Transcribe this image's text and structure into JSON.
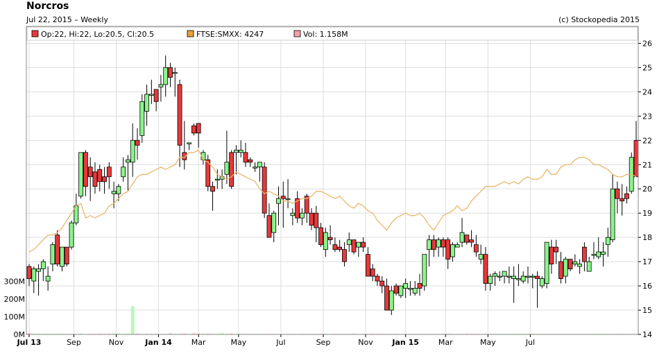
{
  "header": {
    "title": "Norcros",
    "subtitle": "Jul 22, 2015 – Weekly",
    "copyright": "(c) Stockopedia 2015"
  },
  "legend": [
    {
      "label": "Op:22, Hi:22, Lo:20.5, Cl:20.5",
      "color": "#e8383a"
    },
    {
      "label": "FTSE:SMXX: 4247",
      "color": "#e8a23a"
    },
    {
      "label": "Vol: 1.158M",
      "color": "#f2a0a8"
    }
  ],
  "colors": {
    "up": "#8af58a",
    "down": "#e8383a",
    "index_line": "#e9b76a",
    "grid": "#dddddd"
  },
  "chart_data": {
    "type": "candlestick",
    "x_ticks": [
      {
        "label": "Jul 13",
        "bold": true
      },
      {
        "label": "Sep",
        "bold": false
      },
      {
        "label": "Nov",
        "bold": false
      },
      {
        "label": "Jan 14",
        "bold": true
      },
      {
        "label": "Mar",
        "bold": false
      },
      {
        "label": "May",
        "bold": false
      },
      {
        "label": "Jul",
        "bold": false
      },
      {
        "label": "Sep",
        "bold": false
      },
      {
        "label": "Nov",
        "bold": false
      },
      {
        "label": "Jan 15",
        "bold": true
      },
      {
        "label": "Mar",
        "bold": false
      },
      {
        "label": "May",
        "bold": false
      },
      {
        "label": "Jul",
        "bold": false
      }
    ],
    "x_tick_weeks": [
      0,
      9.5,
      18.5,
      27.5,
      36,
      44.5,
      53.5,
      62.5,
      71.5,
      80,
      88.5,
      97.5,
      106.5
    ],
    "y_right_ticks": [
      14,
      15,
      16,
      17,
      18,
      19,
      20,
      21,
      22,
      23,
      24,
      25,
      26
    ],
    "ylim": [
      14,
      26.7
    ],
    "volume_ticks": [
      "0M",
      "100M",
      "200M",
      "300M"
    ],
    "volume_max": 330,
    "series": [
      {
        "name": "Norcros",
        "ohlc": [
          [
            16.8,
            16.9,
            16,
            16.3
          ],
          [
            16.2,
            16.8,
            15.7,
            16.7
          ],
          [
            16.6,
            16.9,
            15.6,
            16.7
          ],
          [
            16.7,
            17.1,
            16.2,
            17
          ],
          [
            16.2,
            16.8,
            15.8,
            16.4
          ],
          [
            16.9,
            17.8,
            16.6,
            17.7
          ],
          [
            18.1,
            18.3,
            16.8,
            16.9
          ],
          [
            16.8,
            17.6,
            16.6,
            17.6
          ],
          [
            17.6,
            17.6,
            16.8,
            16.9
          ],
          [
            17.6,
            18.7,
            17.5,
            18.6
          ],
          [
            18.6,
            19.8,
            18.5,
            19.3
          ],
          [
            19.7,
            21.4,
            19.6,
            21.5
          ],
          [
            21.5,
            21.6,
            19.7,
            20.1
          ],
          [
            20.9,
            21.3,
            19.5,
            20.5
          ],
          [
            20.7,
            21.1,
            19.8,
            20.1
          ],
          [
            20.8,
            21.0,
            19.9,
            20.3
          ],
          [
            20.5,
            20.9,
            19.8,
            20.3
          ],
          [
            20.9,
            21.1,
            20.0,
            20.5
          ],
          [
            19.8,
            20.3,
            19.2,
            19.9
          ],
          [
            19.8,
            20.2,
            19.5,
            20.1
          ],
          [
            20.5,
            21.3,
            20.3,
            20.9
          ],
          [
            21.1,
            21.4,
            19.9,
            21.2
          ],
          [
            21.1,
            22.7,
            20.5,
            22.0
          ],
          [
            22.0,
            22.5,
            21.2,
            21.8
          ],
          [
            22.2,
            23.9,
            21.9,
            23.6
          ],
          [
            23.2,
            24.3,
            22.6,
            23.9
          ],
          [
            23.9,
            24.5,
            23.5,
            23.9
          ],
          [
            24.1,
            24.1,
            23.2,
            23.6
          ],
          [
            24.2,
            24.7,
            23.6,
            24.3
          ],
          [
            24.3,
            25.5,
            23.8,
            25.0
          ],
          [
            25.0,
            25.2,
            24.2,
            24.6
          ],
          [
            24.8,
            25.0,
            23.8,
            24.8
          ],
          [
            24.3,
            24.5,
            20.9,
            21.8
          ],
          [
            21.5,
            22.8,
            20.8,
            21.2
          ],
          [
            21.9,
            21.9,
            21.6,
            21.9
          ],
          [
            22.6,
            22.7,
            22.2,
            22.3
          ],
          [
            22.7,
            22.7,
            21.7,
            22.3
          ],
          [
            21.2,
            21.6,
            21.0,
            21.5
          ],
          [
            21.2,
            21.4,
            19.9,
            20.1
          ],
          [
            20.1,
            20.3,
            19.1,
            19.9
          ],
          [
            20.4,
            20.8,
            20.0,
            20.4
          ],
          [
            20.4,
            20.8,
            20.0,
            20.5
          ],
          [
            20.6,
            22.4,
            20.2,
            21.1
          ],
          [
            21.5,
            21.6,
            20.0,
            20.1
          ],
          [
            21.5,
            21.8,
            20.6,
            21.6
          ],
          [
            21.5,
            22.0,
            21.3,
            21.6
          ],
          [
            21.5,
            21.9,
            20.9,
            21.1
          ],
          [
            21.2,
            21.3,
            20.9,
            21.1
          ],
          [
            20.9,
            21.1,
            20.7,
            20.9
          ],
          [
            20.9,
            21.0,
            20.3,
            21.1
          ],
          [
            20.9,
            21.1,
            18.8,
            19.0
          ],
          [
            18.9,
            19.4,
            18.0,
            18.0
          ],
          [
            18.2,
            19.1,
            17.8,
            19.0
          ],
          [
            19.4,
            20.1,
            18.5,
            19.6
          ],
          [
            19.7,
            20.3,
            18.4,
            19.6
          ],
          [
            19.6,
            20.4,
            19.2,
            19.6
          ],
          [
            18.9,
            19.2,
            18.5,
            19.0
          ],
          [
            19.6,
            19.9,
            18.6,
            18.8
          ],
          [
            18.8,
            19.2,
            18.5,
            19.0
          ],
          [
            19.7,
            19.8,
            18.6,
            19.0
          ],
          [
            19.0,
            19.2,
            18.3,
            18.5
          ],
          [
            19.0,
            19.3,
            17.8,
            18.4
          ],
          [
            18.4,
            18.6,
            17.6,
            17.7
          ],
          [
            17.5,
            18.4,
            17.2,
            18.2
          ],
          [
            18.0,
            18.5,
            17.7,
            17.9
          ],
          [
            17.7,
            18.0,
            17.4,
            17.5
          ],
          [
            17.6,
            17.9,
            17.4,
            17.5
          ],
          [
            17.5,
            17.8,
            16.8,
            17.0
          ],
          [
            17.7,
            18.2,
            17.4,
            17.9
          ],
          [
            17.9,
            17.9,
            17.3,
            17.4
          ],
          [
            17.6,
            17.8,
            17.2,
            17.8
          ],
          [
            17.8,
            18.0,
            17.4,
            17.6
          ],
          [
            17.3,
            17.6,
            16.5,
            16.4
          ],
          [
            16.7,
            16.9,
            16.2,
            16.4
          ],
          [
            16.4,
            16.5,
            16.0,
            16.2
          ],
          [
            16.2,
            16.4,
            15.7,
            16.0
          ],
          [
            16.0,
            16.3,
            15.0,
            15.0
          ],
          [
            15.0,
            16.0,
            14.8,
            15.8
          ],
          [
            16.0,
            16.1,
            15.6,
            15.7
          ],
          [
            15.6,
            16.0,
            15.5,
            16.0
          ],
          [
            15.9,
            16.3,
            15.5,
            16.1
          ],
          [
            15.9,
            16.2,
            15.6,
            15.9
          ],
          [
            15.7,
            16.2,
            15.6,
            15.9
          ],
          [
            16.1,
            16.5,
            15.6,
            15.9
          ],
          [
            16.0,
            17.2,
            15.8,
            17.3
          ],
          [
            17.5,
            18.1,
            16.8,
            17.9
          ],
          [
            17.9,
            18.1,
            17.2,
            17.5
          ],
          [
            17.6,
            18.0,
            17.2,
            17.9
          ],
          [
            17.9,
            18.0,
            17.2,
            17.6
          ],
          [
            17.9,
            18.0,
            16.7,
            17.1
          ],
          [
            17.2,
            17.8,
            17.0,
            17.7
          ],
          [
            17.6,
            17.8,
            17.6,
            17.7
          ],
          [
            17.8,
            18.8,
            17.6,
            18.2
          ],
          [
            18.1,
            18.1,
            17.7,
            17.8
          ],
          [
            17.9,
            18.3,
            17.6,
            17.8
          ],
          [
            17.7,
            18.1,
            17.2,
            17.4
          ],
          [
            17.1,
            17.7,
            16.9,
            17.3
          ],
          [
            17.3,
            17.6,
            15.8,
            16.1
          ],
          [
            16.1,
            16.5,
            15.8,
            16.4
          ],
          [
            16.4,
            16.6,
            16.0,
            16.5
          ],
          [
            16.4,
            16.6,
            16.2,
            16.4
          ],
          [
            16.4,
            16.5,
            16.1,
            16.6
          ],
          [
            16.4,
            16.8,
            16.1,
            16.4
          ],
          [
            16.3,
            16.8,
            15.3,
            16.4
          ],
          [
            16.3,
            16.9,
            16.0,
            16.3
          ],
          [
            16.2,
            16.6,
            16.1,
            16.4
          ],
          [
            16.4,
            16.8,
            16.1,
            16.4
          ],
          [
            16.4,
            16.5,
            15.9,
            16.4
          ],
          [
            16.4,
            16.6,
            15.1,
            16.3
          ],
          [
            16.0,
            16.4,
            15.9,
            16.3
          ],
          [
            16.1,
            17.8,
            15.9,
            17.8
          ],
          [
            17.6,
            17.9,
            16.5,
            16.9
          ],
          [
            17.6,
            17.9,
            16.9,
            17.4
          ],
          [
            17.0,
            17.4,
            16.1,
            16.3
          ],
          [
            16.4,
            17.2,
            16.1,
            17.1
          ],
          [
            17.1,
            17.1,
            16.6,
            16.7
          ],
          [
            16.9,
            17.3,
            16.8,
            17.0
          ],
          [
            16.8,
            17.1,
            16.5,
            16.9
          ],
          [
            17.6,
            17.8,
            16.6,
            17.0
          ],
          [
            16.6,
            17.2,
            16.6,
            17.0
          ],
          [
            17.3,
            17.8,
            17.1,
            17.3
          ],
          [
            17.2,
            18.0,
            17.1,
            17.4
          ],
          [
            17.3,
            17.8,
            16.8,
            17.4
          ],
          [
            17.7,
            18.4,
            17.2,
            18.0
          ],
          [
            17.9,
            20.6,
            17.8,
            20.0
          ],
          [
            20.0,
            20.3,
            19.0,
            19.6
          ],
          [
            19.6,
            20.2,
            18.9,
            19.5
          ],
          [
            19.8,
            20.1,
            19.4,
            19.6
          ],
          [
            19.9,
            21.5,
            19.8,
            21.3
          ],
          [
            22.0,
            22.8,
            20.5,
            20.5
          ]
        ]
      }
    ],
    "index_line": {
      "name": "FTSE:SMXX",
      "values": [
        17.4,
        17.5,
        17.7,
        17.9,
        18.1,
        18.1,
        18.2,
        18.4,
        18.7,
        19.0,
        19.3,
        19.4,
        18.8,
        18.9,
        18.8,
        18.9,
        19.0,
        19.3,
        19.4,
        19.6,
        19.8,
        19.9,
        20.2,
        20.5,
        20.6,
        20.6,
        20.7,
        20.8,
        20.9,
        20.8,
        20.9,
        21.0,
        21.3,
        21.3,
        21.5,
        21.5,
        21.6,
        21.2,
        21.1,
        20.9,
        20.6,
        20.5,
        20.4,
        20.5,
        20.7,
        20.6,
        20.5,
        20.4,
        20.3,
        20.0,
        19.8,
        19.9,
        19.8,
        19.7,
        19.5,
        19.5,
        19.4,
        19.5,
        19.6,
        19.6,
        19.7,
        19.9,
        19.9,
        19.8,
        19.7,
        19.6,
        19.7,
        19.5,
        19.3,
        19.2,
        19.4,
        19.3,
        19.1,
        19.0,
        18.7,
        18.5,
        18.3,
        18.6,
        18.8,
        18.9,
        19.0,
        18.9,
        18.9,
        19.0,
        18.8,
        18.5,
        18.3,
        18.6,
        18.9,
        19.0,
        19.1,
        19.3,
        19.1,
        19.2,
        19.5,
        19.7,
        19.9,
        20.1,
        20.1,
        20.1,
        20.2,
        20.3,
        20.2,
        20.3,
        20.2,
        20.4,
        20.5,
        20.4,
        20.4,
        20.5,
        20.8,
        20.6,
        20.6,
        20.9,
        21.0,
        21.0,
        21.2,
        21.3,
        21.3,
        21.2,
        21.0,
        21.0,
        20.9,
        20.8,
        20.6,
        20.5,
        20.5,
        20.6,
        20.6,
        20.5,
        20.7
      ]
    },
    "volume": [
      8,
      5,
      4,
      3,
      4,
      3,
      3,
      4,
      3,
      3,
      3,
      5,
      2,
      3,
      3,
      4,
      3,
      4,
      5,
      6,
      3,
      5,
      160,
      5,
      3,
      4,
      3,
      3,
      2,
      3,
      6,
      3,
      4,
      5,
      3,
      6,
      5,
      4,
      4,
      3,
      3,
      7,
      4,
      5,
      3,
      3,
      3,
      3,
      3,
      4,
      3,
      3,
      3,
      2,
      2,
      3,
      3,
      2,
      3,
      3,
      3,
      3,
      4,
      4,
      2,
      3,
      3,
      3,
      3,
      4,
      3,
      3,
      3,
      4,
      3,
      3,
      3,
      3,
      3,
      2,
      3,
      3,
      3,
      3,
      3,
      3,
      3,
      3,
      4,
      4,
      3,
      3,
      3,
      4,
      3,
      3,
      3,
      3,
      3,
      3,
      3,
      3,
      3,
      3,
      3,
      3,
      3,
      4,
      3,
      3,
      3,
      3,
      3,
      3,
      3,
      3,
      3,
      3,
      3,
      3,
      3,
      3,
      3,
      3,
      3,
      3,
      3,
      3,
      3,
      3,
      3,
      3,
      4,
      4,
      6,
      3,
      4,
      5,
      4
    ]
  }
}
